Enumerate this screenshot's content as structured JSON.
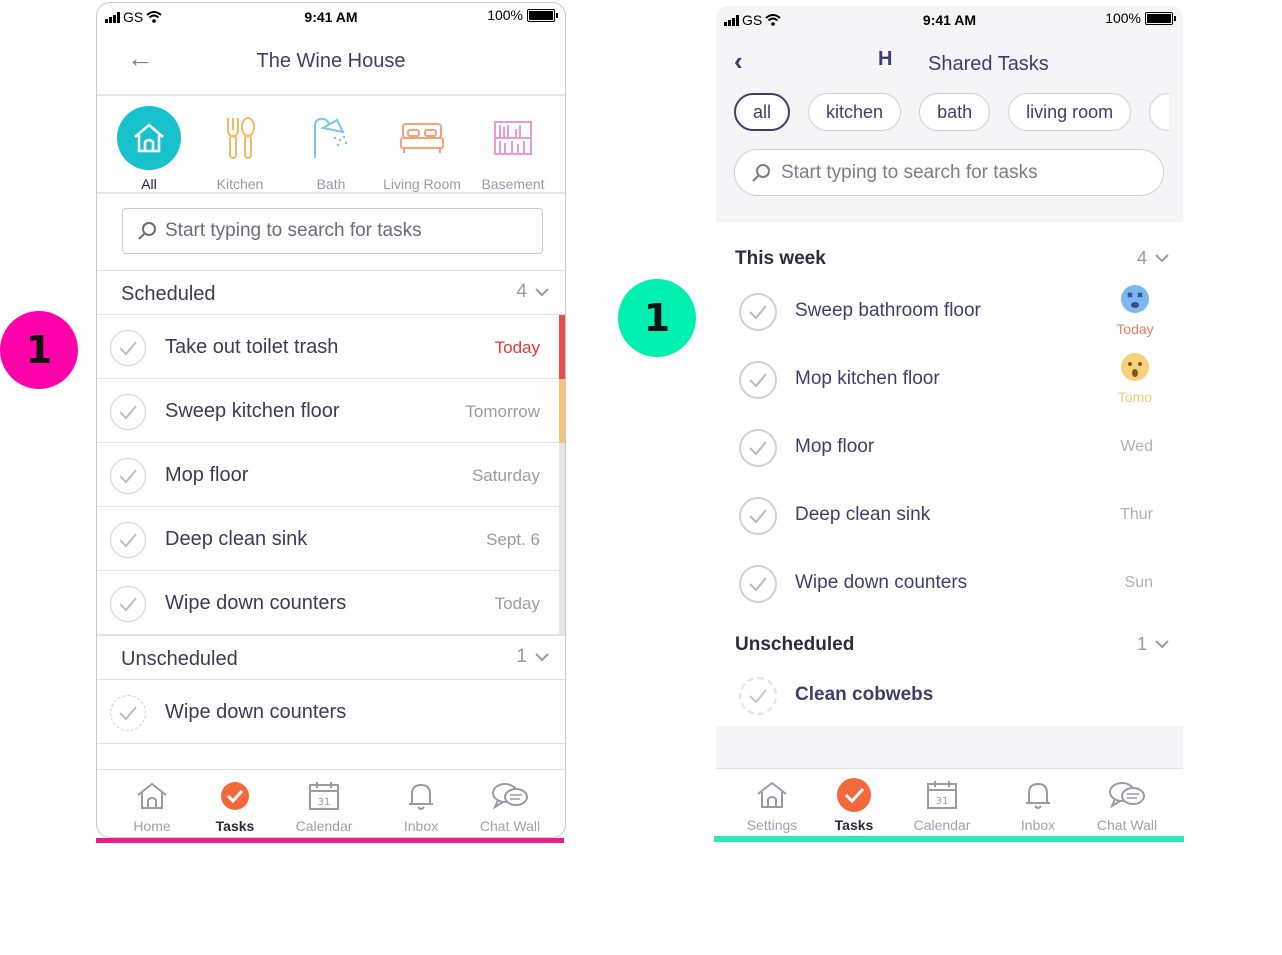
{
  "badges": {
    "left": "1",
    "right": "1"
  },
  "colors": {
    "pink": "#ee1a8e",
    "teal": "#18c2cc",
    "mint": "#2ee8b6",
    "orange": "#f26a3b",
    "red": "#e53935",
    "amber": "#f5c57a"
  },
  "status": {
    "carrier": "GS",
    "time": "9:41 AM",
    "battery": "100%"
  },
  "phone1": {
    "title": "The Wine House",
    "categories": [
      {
        "label": "All",
        "icon": "house-icon"
      },
      {
        "label": "Kitchen",
        "icon": "utensils-icon"
      },
      {
        "label": "Bath",
        "icon": "shower-icon"
      },
      {
        "label": "Living Room",
        "icon": "bed-icon"
      },
      {
        "label": "Basement",
        "icon": "bookshelf-icon"
      }
    ],
    "search_placeholder": "Start typing to search for tasks",
    "scheduled": {
      "title": "Scheduled",
      "count": "4",
      "tasks": [
        {
          "name": "Take out toilet trash",
          "date": "Today",
          "bar": "#ef4b4b"
        },
        {
          "name": "Sweep kitchen floor",
          "date": "Tomorrow",
          "bar": "#f5c57a"
        },
        {
          "name": "Mop floor",
          "date": "Saturday",
          "bar": "#e6e6e8"
        },
        {
          "name": "Deep clean sink",
          "date": "Sept. 6",
          "bar": "#e6e6e8"
        },
        {
          "name": "Wipe down counters",
          "date": "Today",
          "bar": "#e6e6e8"
        }
      ]
    },
    "unscheduled": {
      "title": "Unscheduled",
      "count": "1",
      "tasks": [
        {
          "name": "Wipe down counters"
        }
      ]
    },
    "tabs": [
      {
        "label": "Home",
        "icon": "house-icon"
      },
      {
        "label": "Tasks",
        "icon": "check-circle-icon"
      },
      {
        "label": "Calendar",
        "icon": "calendar-icon",
        "day": "31"
      },
      {
        "label": "Inbox",
        "icon": "bell-icon"
      },
      {
        "label": "Chat Wall",
        "icon": "chat-icon"
      }
    ]
  },
  "phone2": {
    "ghost_title": "H",
    "title": "Shared Tasks",
    "chips": [
      "all",
      "kitchen",
      "bath",
      "living room"
    ],
    "search_placeholder": "Start typing to search for tasks",
    "this_week": {
      "title": "This week",
      "count": "4",
      "tasks": [
        {
          "name": "Sweep bathroom floor",
          "date": "Today",
          "emoji": "dizzy-face-icon"
        },
        {
          "name": "Mop kitchen floor",
          "date": "Tomo",
          "emoji": "surprised-face-icon"
        },
        {
          "name": "Mop floor",
          "date": "Wed"
        },
        {
          "name": "Deep clean sink",
          "date": "Thur"
        },
        {
          "name": "Wipe down counters",
          "date": "Sun"
        }
      ]
    },
    "unscheduled": {
      "title": "Unscheduled",
      "count": "1",
      "tasks": [
        {
          "name": "Clean cobwebs"
        }
      ]
    },
    "tabs": [
      {
        "label": "Settings",
        "icon": "house-icon"
      },
      {
        "label": "Tasks",
        "icon": "check-circle-icon"
      },
      {
        "label": "Calendar",
        "icon": "calendar-icon",
        "day": "31"
      },
      {
        "label": "Inbox",
        "icon": "bell-icon"
      },
      {
        "label": "Chat Wall",
        "icon": "chat-icon"
      }
    ]
  }
}
